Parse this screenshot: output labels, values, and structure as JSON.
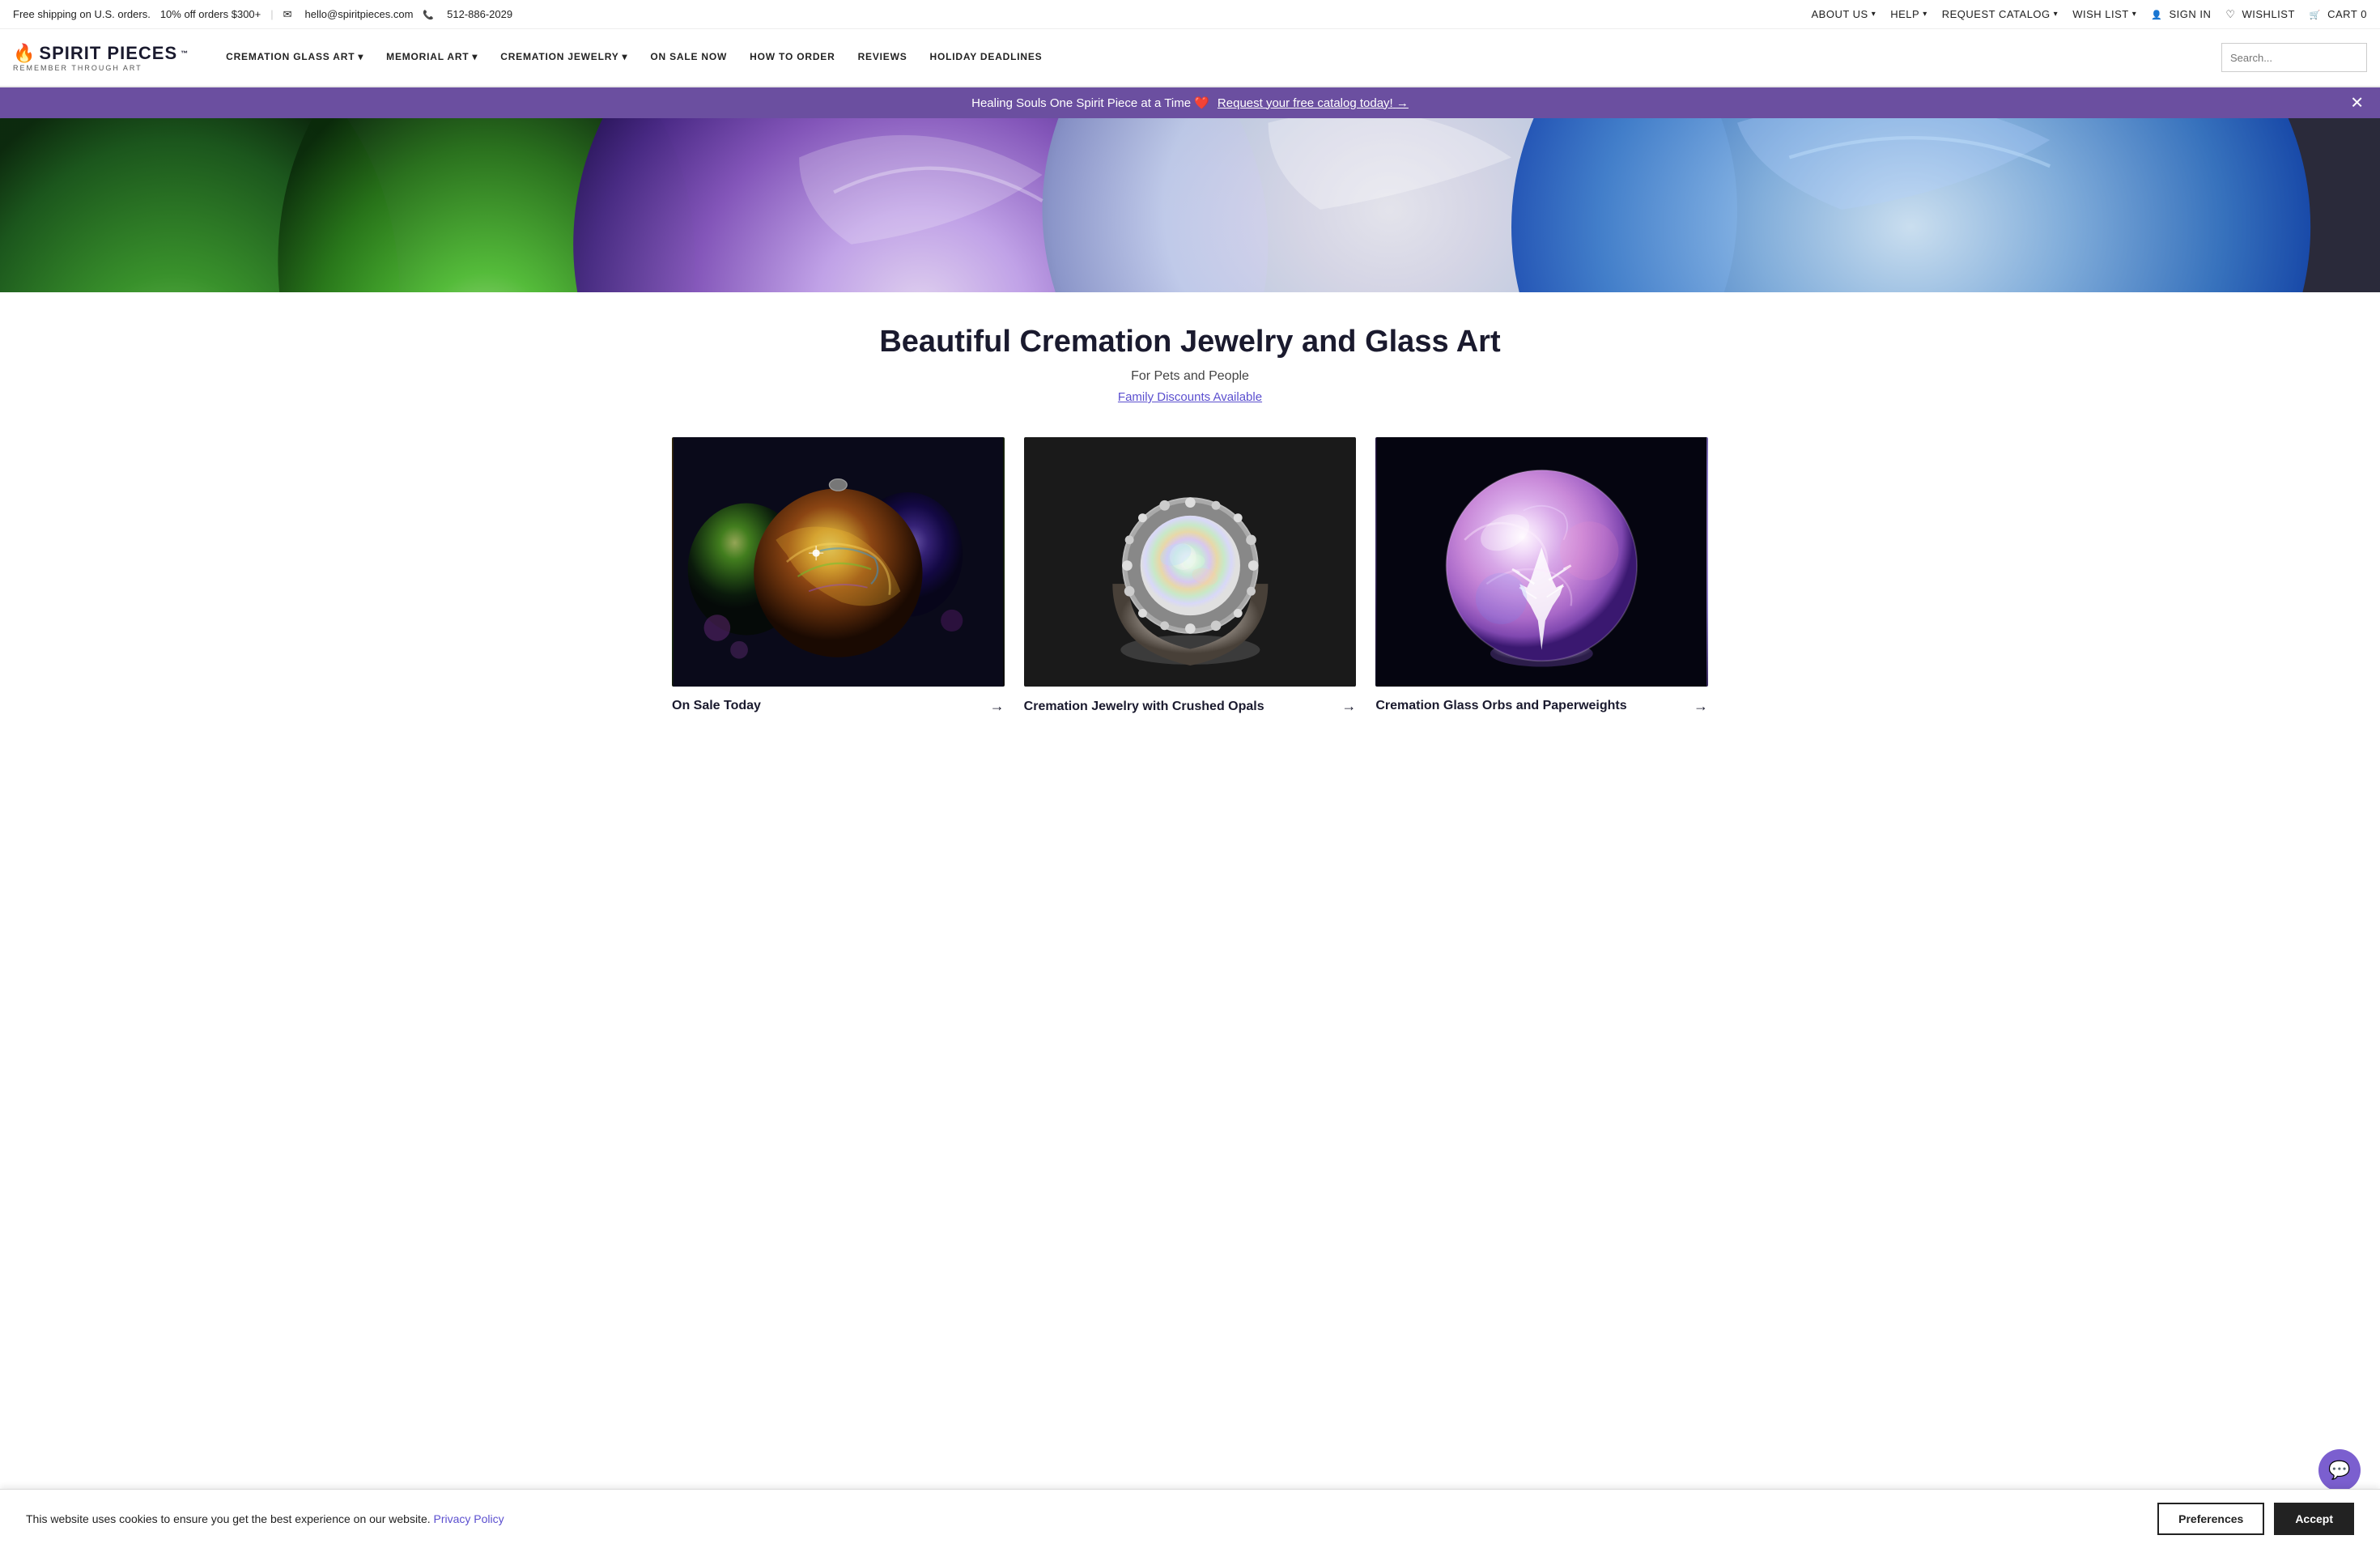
{
  "topbar": {
    "shipping_text": "Free shipping on U.S. orders.",
    "shipping_extra": " 10% off orders $300+",
    "email": "hello@spiritpieces.com",
    "phone": "512-886-2029",
    "nav_items": [
      {
        "label": "ABOUT US",
        "has_dropdown": true
      },
      {
        "label": "HELP",
        "has_dropdown": true
      },
      {
        "label": "REQUEST CATALOG",
        "has_dropdown": true
      },
      {
        "label": "WISH LIST",
        "has_dropdown": true
      },
      {
        "label": "SIGN IN",
        "has_dropdown": false
      },
      {
        "label": "WISHLIST",
        "has_dropdown": false
      },
      {
        "label": "CART",
        "count": "0",
        "has_dropdown": false
      }
    ]
  },
  "logo": {
    "name": "SPIRIT PIECES",
    "tagline": "REMEMBER THROUGH ART"
  },
  "mainnav": {
    "links": [
      {
        "label": "CREMATION GLASS ART",
        "has_dropdown": true
      },
      {
        "label": "MEMORIAL ART",
        "has_dropdown": true
      },
      {
        "label": "CREMATION JEWELRY",
        "has_dropdown": true
      },
      {
        "label": "ON SALE NOW",
        "has_dropdown": false
      },
      {
        "label": "HOW TO ORDER",
        "has_dropdown": false
      },
      {
        "label": "REVIEWS",
        "has_dropdown": false
      },
      {
        "label": "HOLIDAY DEADLINES",
        "has_dropdown": false
      }
    ],
    "search_placeholder": "Search..."
  },
  "promo_banner": {
    "text": "Healing Souls One Spirit Piece at a Time ❤️",
    "link_text": "Request your free catalog today!",
    "arrow": "→"
  },
  "hero_section": {
    "title": "Beautiful Cremation Jewelry and Glass Art",
    "subtitle": "For Pets and People",
    "link": "Family Discounts Available"
  },
  "products": [
    {
      "label": "On Sale Today",
      "arrow": "→",
      "color_scheme": "ornament"
    },
    {
      "label": "Cremation Jewelry with Crushed Opals",
      "arrow": "→",
      "color_scheme": "ring"
    },
    {
      "label": "Cremation Glass Orbs and Paperweights",
      "arrow": "→",
      "color_scheme": "orb"
    }
  ],
  "cookie": {
    "text": "This website uses cookies to ensure you get the best experience on our website.",
    "policy_text": "Privacy Policy",
    "preferences_label": "Preferences",
    "accept_label": "Accept"
  },
  "chat": {
    "icon": "💬"
  }
}
